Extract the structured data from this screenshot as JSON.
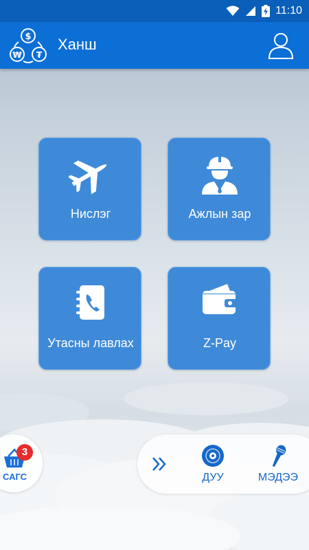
{
  "status_bar": {
    "time": "11:10"
  },
  "app_bar": {
    "title": "Ханш"
  },
  "tiles": [
    {
      "label": "Нислэг",
      "icon": "airplane-icon"
    },
    {
      "label": "Ажлын зар",
      "icon": "worker-helmet-icon"
    },
    {
      "label": "Утасны лавлах",
      "icon": "phonebook-icon"
    },
    {
      "label": "Z-Pay",
      "icon": "wallet-icon"
    }
  ],
  "cart": {
    "label": "САГС",
    "badge_count": "3",
    "icon": "basket-icon"
  },
  "dock": {
    "expand_icon": "double-chevron-right-icon",
    "items": [
      {
        "label": "ДУУ",
        "icon": "disc-icon"
      },
      {
        "label": "МЭДЭЭ",
        "icon": "microphone-icon"
      }
    ]
  },
  "colors": {
    "status_bar": "#0a5fb8",
    "app_bar": "#0c6fd6",
    "tile": "#3e8ad8",
    "accent": "#1667c8",
    "badge": "#e82b2b"
  }
}
